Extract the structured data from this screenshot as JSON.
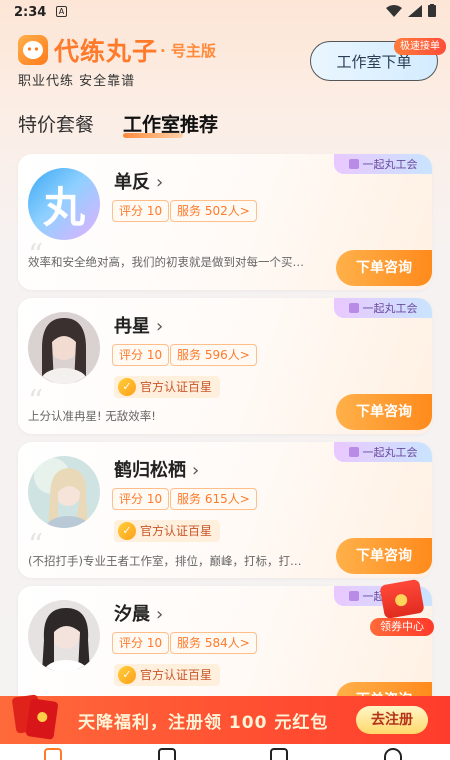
{
  "status_bar": {
    "time": "2:34"
  },
  "header": {
    "app_name": "代练丸子",
    "edition": "· 号主版",
    "slogan": "职业代练 安全靠谱",
    "studio_order_label": "工作室下单",
    "fast_badge": "极速接单"
  },
  "tabs": [
    {
      "label": "特价套餐",
      "active": false
    },
    {
      "label": "工作室推荐",
      "active": true
    }
  ],
  "guild_tag": "一起丸工会",
  "consult_label": "下单咨询",
  "studios": [
    {
      "name": "单反",
      "score": "评分 10",
      "served": "服务 502人>",
      "cert": "",
      "description": "效率和安全绝对高，我们的初衷就是做到对每一个买…"
    },
    {
      "name": "冉星",
      "score": "评分 10",
      "served": "服务 596人>",
      "cert": "官方认证百星",
      "description": "上分认准冉星! 无敌效率!"
    },
    {
      "name": "鹤归松栖",
      "score": "评分 10",
      "served": "服务 615人>",
      "cert": "官方认证百星",
      "description": "(不招打手)专业王者工作室，排位，巅峰，打标，打…"
    },
    {
      "name": "汐晨",
      "score": "评分 10",
      "served": "服务 584人>",
      "cert": "官方认证百星",
      "description": ""
    }
  ],
  "avatar_brand_char": "丸",
  "coupon_center": "领券中心",
  "promo": {
    "text": "天降福利，注册领 100 元红包",
    "button": "去注册"
  },
  "colors": {
    "accent": "#ff7a2a",
    "button": "#ff9a2a",
    "promo": "#ff4a30"
  }
}
